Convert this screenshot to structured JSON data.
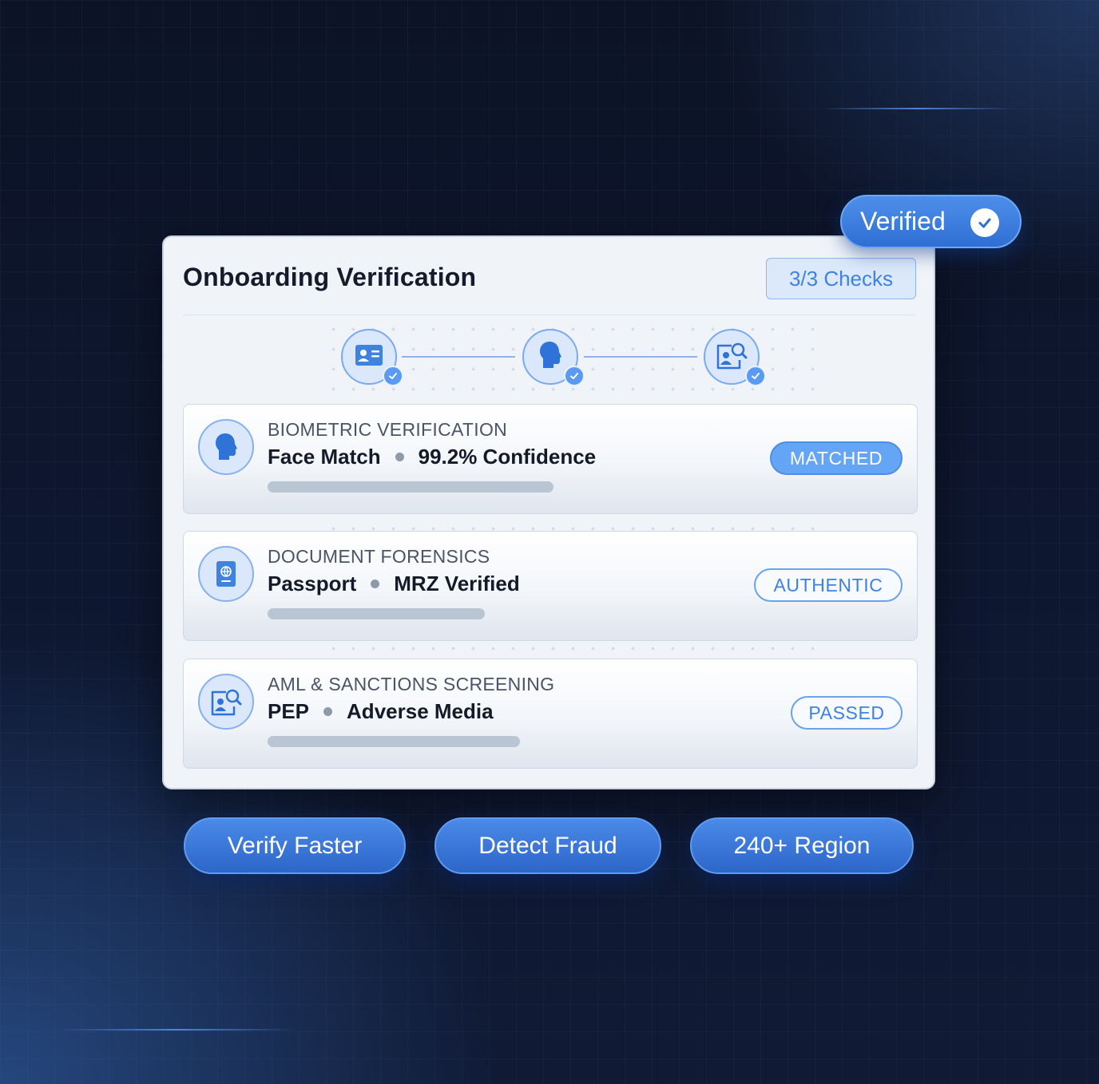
{
  "card": {
    "title": "Onboarding Verification",
    "checks_badge": "3/3 Checks"
  },
  "verified_badge": {
    "label": "Verified",
    "icon": "check-circle-icon"
  },
  "steps": [
    {
      "icon": "id-card-icon",
      "status_icon": "check-icon"
    },
    {
      "icon": "face-profile-icon",
      "status_icon": "check-icon"
    },
    {
      "icon": "person-search-icon",
      "status_icon": "check-icon"
    }
  ],
  "checks": [
    {
      "label": "BIOMETRIC VERIFICATION",
      "detail_left": "Face Match",
      "detail_right": "99.2% Confidence",
      "status": "MATCHED",
      "icon": "face-profile-icon"
    },
    {
      "label": "DOCUMENT FORENSICS",
      "detail_left": "Passport",
      "detail_right": "MRZ Verified",
      "status": "AUTHENTIC",
      "icon": "passport-icon"
    },
    {
      "label": "AML & SANCTIONS SCREENING",
      "detail_left": "PEP",
      "detail_right": "Adverse Media",
      "status": "PASSED",
      "icon": "person-search-icon"
    }
  ],
  "features": [
    "Verify Faster",
    "Detect Fraud",
    "240+ Region"
  ],
  "colors": {
    "accent": "#3f82e0",
    "badge_fill": "#64a5f5",
    "background": "#0e1730"
  }
}
